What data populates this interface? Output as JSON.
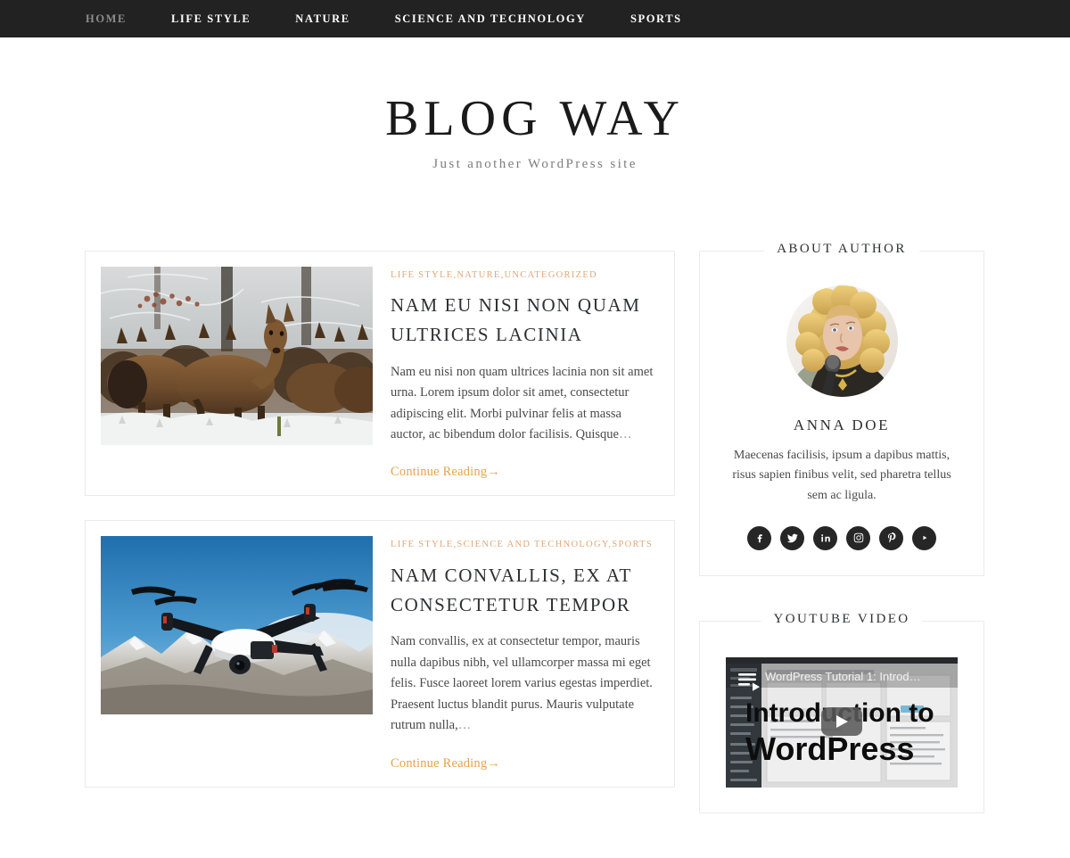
{
  "nav": {
    "items": [
      {
        "label": "HOME",
        "current": true
      },
      {
        "label": "LIFE STYLE",
        "current": false
      },
      {
        "label": "NATURE",
        "current": false
      },
      {
        "label": "SCIENCE AND TECHNOLOGY",
        "current": false
      },
      {
        "label": "SPORTS",
        "current": false
      }
    ]
  },
  "header": {
    "title": "BLOG WAY",
    "tagline": "Just another WordPress site"
  },
  "posts": [
    {
      "categories": [
        "LIFE STYLE",
        "NATURE",
        "UNCATEGORIZED"
      ],
      "title": "NAM EU NISI NON QUAM ULTRICES LACINIA",
      "excerpt": "Nam eu nisi non quam ultrices lacinia non sit amet urna. Lorem ipsum dolor sit amet, consectetur adipiscing elit. Morbi pulvinar felis at massa auctor, ac bibendum dolor facilisis. Quisque",
      "ellipsis": "…",
      "read_more": "Continue Reading→",
      "image_alt": "herd-of-deer-in-snowy-forest"
    },
    {
      "categories": [
        "LIFE STYLE",
        "SCIENCE AND TECHNOLOGY",
        "SPORTS"
      ],
      "title": "NAM CONVALLIS, EX AT CONSECTETUR TEMPOR",
      "excerpt": "Nam convallis, ex at consectetur tempor, mauris nulla dapibus nibh, vel ullamcorper massa mi eget felis. Fusce laoreet lorem varius egestas imperdiet. Praesent luctus blandit purus. Mauris vulputate rutrum nulla,",
      "ellipsis": "…",
      "read_more": "Continue Reading→",
      "image_alt": "black-drone-flying-over-snowy-mountains"
    }
  ],
  "sidebar": {
    "about": {
      "widget_title": "ABOUT AUTHOR",
      "avatar_alt": "blonde-woman-holding-microphone",
      "name": "ANNA DOE",
      "bio": "Maecenas facilisis, ipsum a dapibus mattis, risus sapien finibus velit, sed pharetra tellus sem ac ligula.",
      "socials": [
        {
          "name": "facebook"
        },
        {
          "name": "twitter"
        },
        {
          "name": "linkedin"
        },
        {
          "name": "instagram"
        },
        {
          "name": "pinterest"
        },
        {
          "name": "youtube"
        }
      ]
    },
    "video": {
      "widget_title": "YOUTUBE VIDEO",
      "video_title": "WordPress Tutorial 1: Introd…",
      "overlay_line1": "Introduction to",
      "overlay_line2": "WordPress"
    }
  },
  "colors": {
    "nav_bg": "#222222",
    "accent": "#e8a24a",
    "category": "#e0a877",
    "text": "#2e3033",
    "border": "#ebebeb"
  }
}
